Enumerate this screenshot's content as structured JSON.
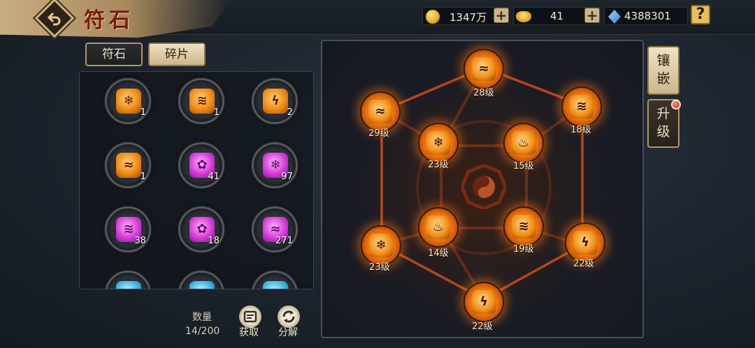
{
  "header": {
    "title": "符石"
  },
  "resources": [
    {
      "icon": "gold-coin-icon",
      "value": "1347万"
    },
    {
      "icon": "gold-ingot-icon",
      "value": "41"
    },
    {
      "icon": "diamond-gem-icon",
      "value": "4388301"
    }
  ],
  "help_label": "?",
  "tabs": [
    {
      "label": "符石",
      "active": false
    },
    {
      "label": "碎片",
      "active": true
    }
  ],
  "inventory": [
    {
      "color": "orange",
      "glyph": "❄",
      "count": "1"
    },
    {
      "color": "orange",
      "glyph": "≋",
      "count": "1"
    },
    {
      "color": "orange",
      "glyph": "ϟ",
      "count": "2"
    },
    {
      "color": "orange",
      "glyph": "≈",
      "count": "1"
    },
    {
      "color": "purple",
      "glyph": "✿",
      "count": "41"
    },
    {
      "color": "purple",
      "glyph": "❄",
      "count": "97"
    },
    {
      "color": "purple",
      "glyph": "≋",
      "count": "38"
    },
    {
      "color": "purple",
      "glyph": "✿",
      "count": "18"
    },
    {
      "color": "purple",
      "glyph": "≈",
      "count": "271"
    },
    {
      "color": "blue",
      "glyph": "",
      "count": ""
    },
    {
      "color": "blue",
      "glyph": "",
      "count": ""
    },
    {
      "color": "blue",
      "glyph": "",
      "count": ""
    }
  ],
  "quantity": {
    "label": "数量",
    "value": "14/200"
  },
  "actions": {
    "obtain_label": "获取",
    "decompose_label": "分解"
  },
  "nodes": [
    {
      "glyph": "≈",
      "level": "28级"
    },
    {
      "glyph": "≋",
      "level": "18级"
    },
    {
      "glyph": "ϟ",
      "level": "22级"
    },
    {
      "glyph": "ϟ",
      "level": "22级"
    },
    {
      "glyph": "❄",
      "level": "23级"
    },
    {
      "glyph": "≈",
      "level": "29级"
    },
    {
      "glyph": "❄",
      "level": "23级"
    },
    {
      "glyph": "♨",
      "level": "15级"
    },
    {
      "glyph": "≋",
      "level": "19级"
    },
    {
      "glyph": "♨",
      "level": "14级"
    }
  ],
  "side_tabs": {
    "inlay_label": "镶嵌",
    "upgrade_label": "升级"
  },
  "colors": {
    "accent_gold": "#c8ad82",
    "rune_orange": "#f08a12",
    "rune_purple": "#d63ad6",
    "title_red": "#7a1a12"
  }
}
